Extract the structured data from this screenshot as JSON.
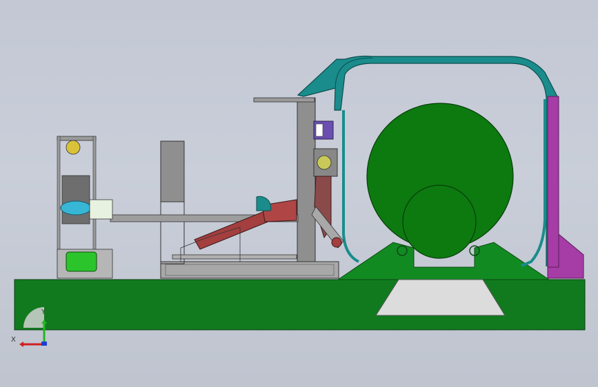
{
  "viewport": {
    "background_top": "#c3c8d4",
    "background_bottom": "#bfc4cf"
  },
  "triad": {
    "x_label": "X",
    "y_label": "Y",
    "x_color": "#d11e1e",
    "y_color": "#1fb81f",
    "z_color": "#1e3cd1"
  },
  "colors": {
    "base_green": "#117a1f",
    "drum_green": "#0d7a10",
    "frame_teal": "#1a8c8c",
    "side_magenta": "#a63ca6",
    "cylinder_red": "#a33f3f",
    "steel_grey": "#8f8f8f",
    "motor_green": "#2bc42b"
  }
}
